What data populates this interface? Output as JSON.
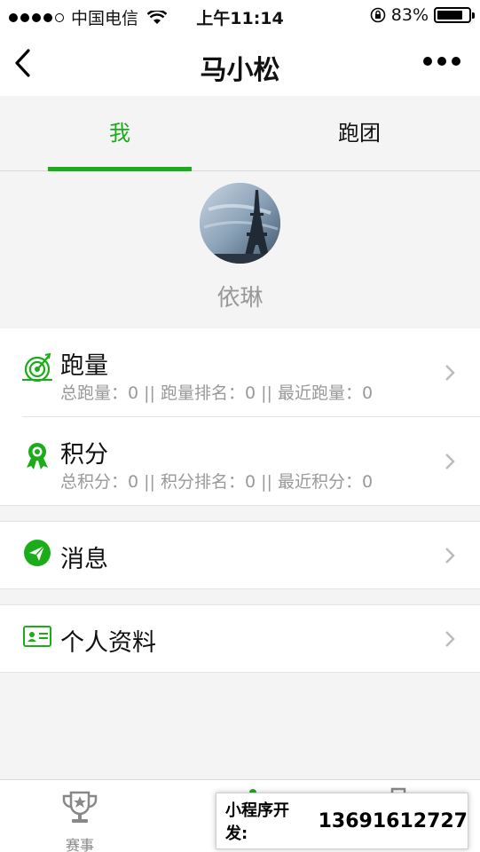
{
  "status_bar": {
    "carrier": "中国电信",
    "time": "上午11:14",
    "battery_percent": "83%",
    "battery_level": 0.83
  },
  "nav": {
    "title": "马小松"
  },
  "tabs": [
    {
      "label": "我",
      "active": true
    },
    {
      "label": "跑团",
      "active": false
    }
  ],
  "profile": {
    "name": "依琳"
  },
  "menu": {
    "running": {
      "title": "跑量",
      "subtitle": "总跑量：0 || 跑量排名：0 || 最近跑量：0"
    },
    "points": {
      "title": "积分",
      "subtitle": "总积分：0 || 积分排名：0 || 最近积分：0"
    },
    "messages": {
      "title": "消息"
    },
    "profile_info": {
      "title": "个人资料"
    }
  },
  "tabbar": {
    "items": [
      {
        "label": "赛事",
        "icon": "trophy-icon"
      }
    ]
  },
  "overlay": {
    "label": "小程序开发:",
    "phone": "13691612727"
  },
  "colors": {
    "accent": "#1aad19",
    "muted_text": "#999999",
    "background": "#f4f4f4"
  }
}
